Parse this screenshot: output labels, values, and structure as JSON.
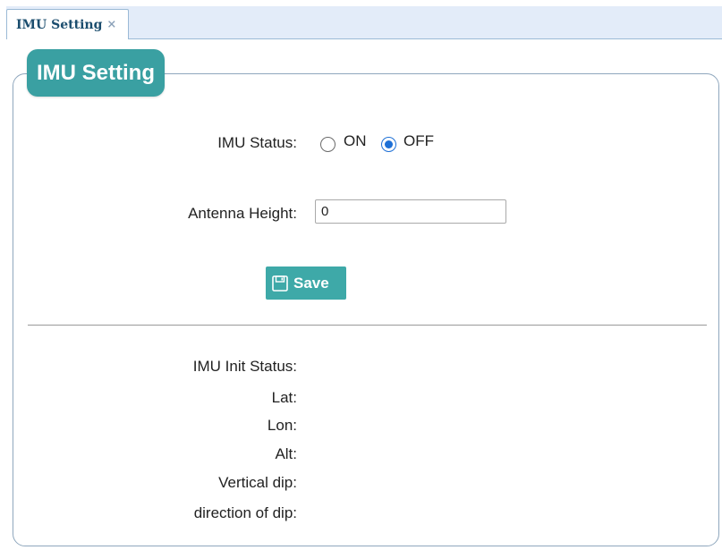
{
  "tab": {
    "label": "IMU Setting",
    "close": "×"
  },
  "panel": {
    "legend": "IMU Setting"
  },
  "form": {
    "imu_status_label": "IMU Status:",
    "imu_status_options": {
      "on": "ON",
      "off": "OFF"
    },
    "imu_status_selected": "OFF",
    "antenna_height_label": "Antenna Height:",
    "antenna_height_value": "0",
    "save_label": "Save"
  },
  "status": {
    "init_status_label": "IMU Init Status:",
    "lat_label": "Lat:",
    "lon_label": "Lon:",
    "alt_label": "Alt:",
    "vertical_dip_label": "Vertical dip:",
    "direction_of_dip_label": "direction of dip:"
  },
  "colors": {
    "accent": "#3aa0a2",
    "tabbar_bg": "#e3ecf9",
    "radio_selected": "#1e70d6"
  },
  "icons": {
    "save": "floppy-disk-icon",
    "close": "close-icon"
  }
}
